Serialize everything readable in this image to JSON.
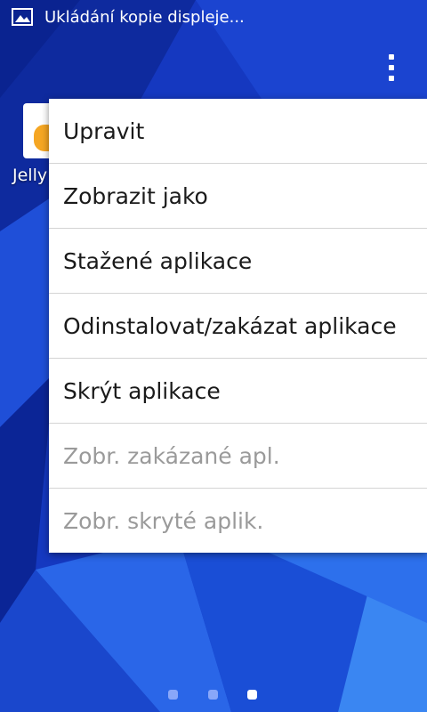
{
  "status_bar": {
    "notification_icon": "image-icon",
    "text": "Ukládání kopie displeje..."
  },
  "home": {
    "app_label": "Jelly"
  },
  "menu": {
    "items": [
      {
        "label": "Upravit",
        "enabled": true
      },
      {
        "label": "Zobrazit jako",
        "enabled": true
      },
      {
        "label": "Stažené aplikace",
        "enabled": true
      },
      {
        "label": "Odinstalovat/zakázat aplikace",
        "enabled": true
      },
      {
        "label": "Skrýt aplikace",
        "enabled": true
      },
      {
        "label": "Zobr. zakázané apl.",
        "enabled": false
      },
      {
        "label": "Zobr. skryté aplik.",
        "enabled": false
      }
    ]
  },
  "pager": {
    "pages": 3,
    "active_page": 3
  },
  "colors": {
    "wallpaper_base": "#1435b8",
    "menu_background": "#ffffff",
    "menu_text": "#1a1a1a",
    "menu_disabled_text": "#9a9a9a"
  }
}
